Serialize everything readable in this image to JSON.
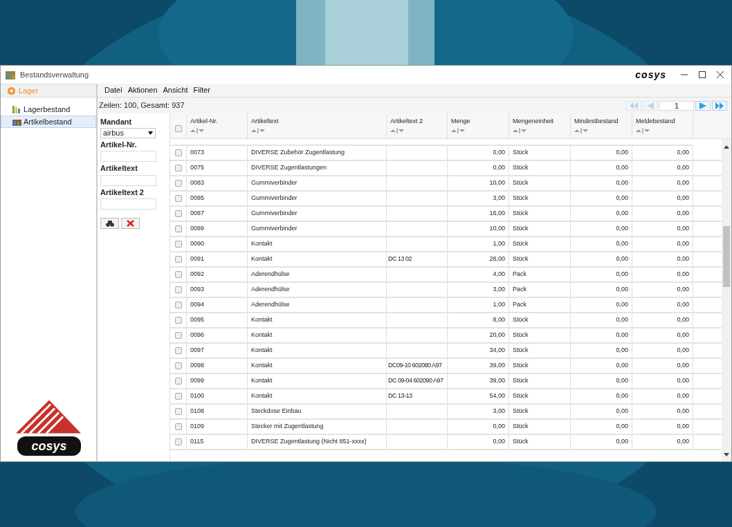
{
  "window": {
    "title": "Bestandsverwaltung",
    "logo": "cosys"
  },
  "sidebar": {
    "header": "Lager",
    "items": [
      {
        "label": "Lagerbestand",
        "selected": false
      },
      {
        "label": "Artikelbestand",
        "selected": true
      }
    ]
  },
  "menu": [
    "Datei",
    "Aktionen",
    "Ansicht",
    "Filter"
  ],
  "status": "Zeilen: 100, Gesamt: 937",
  "pager": {
    "page": "1",
    "first_disabled": true,
    "prev_disabled": true,
    "next_disabled": false,
    "last_disabled": false
  },
  "filter": {
    "mandant_label": "Mandant",
    "mandant_value": "airbus",
    "fields": [
      {
        "label": "Artikel-Nr."
      },
      {
        "label": "Artikeltext"
      },
      {
        "label": "Artikeltext 2"
      }
    ]
  },
  "sidebar_logo": "cosys",
  "table": {
    "select_all_checked": false,
    "columns": [
      "Artikel-Nr.",
      "Artikeltext",
      "Artikeltext 2",
      "Menge",
      "Mengeneinheit",
      "Mindestbestand",
      "Meldebestand"
    ],
    "rows": [
      {
        "checked": false,
        "cells": [
          "0073",
          "DIVERSE Zubehör Zugentlastung",
          "",
          "0,00",
          "Stück",
          "0,00",
          "0,00"
        ]
      },
      {
        "checked": false,
        "cells": [
          "0075",
          "DIVERSE Zugentlastungen",
          "",
          "0,00",
          "Stück",
          "0,00",
          "0,00"
        ]
      },
      {
        "checked": false,
        "cells": [
          "0083",
          "Gummiverbinder",
          "",
          "10,00",
          "Stück",
          "0,00",
          "0,00"
        ]
      },
      {
        "checked": false,
        "cells": [
          "0085",
          "Gummiverbinder",
          "",
          "3,00",
          "Stück",
          "0,00",
          "0,00"
        ]
      },
      {
        "checked": false,
        "cells": [
          "0087",
          "Gummiverbinder",
          "",
          "16,00",
          "Stück",
          "0,00",
          "0,00"
        ]
      },
      {
        "checked": false,
        "cells": [
          "0089",
          "Gummiverbinder",
          "",
          "10,00",
          "Stück",
          "0,00",
          "0,00"
        ]
      },
      {
        "checked": false,
        "cells": [
          "0090",
          "Kontakt",
          "",
          "1,00",
          "Stück",
          "0,00",
          "0,00"
        ]
      },
      {
        "checked": false,
        "cells": [
          "0091",
          "Kontakt",
          "DC 13 02",
          "28,00",
          "Stück",
          "0,00",
          "0,00"
        ]
      },
      {
        "checked": false,
        "cells": [
          "0092",
          "Aderendhülse",
          "",
          "4,00",
          "Pack",
          "0,00",
          "0,00"
        ]
      },
      {
        "checked": false,
        "cells": [
          "0093",
          "Aderendhülse",
          "",
          "3,00",
          "Pack",
          "0,00",
          "0,00"
        ]
      },
      {
        "checked": false,
        "cells": [
          "0094",
          "Aderendhülse",
          "",
          "1,00",
          "Pack",
          "0,00",
          "0,00"
        ]
      },
      {
        "checked": false,
        "cells": [
          "0095",
          "Kontakt",
          "",
          "8,00",
          "Stück",
          "0,00",
          "0,00"
        ]
      },
      {
        "checked": false,
        "cells": [
          "0096",
          "Kontakt",
          "",
          "20,00",
          "Stück",
          "0,00",
          "0,00"
        ]
      },
      {
        "checked": false,
        "cells": [
          "0097",
          "Kontakt",
          "",
          "34,00",
          "Stück",
          "0,00",
          "0,00"
        ]
      },
      {
        "checked": false,
        "cells": [
          "0098",
          "Kontakt",
          "DC09-10 602080 A97",
          "39,00",
          "Stück",
          "0,00",
          "0,00"
        ]
      },
      {
        "checked": false,
        "cells": [
          "0099",
          "Kontakt",
          "DC 09-04 602090 A97",
          "39,00",
          "Stück",
          "0,00",
          "0,00"
        ]
      },
      {
        "checked": false,
        "cells": [
          "0100",
          "Kontakt",
          "DC 13-13",
          "54,00",
          "Stück",
          "0,00",
          "0,00"
        ]
      },
      {
        "checked": false,
        "cells": [
          "0108",
          "Steckdose Einbau",
          "",
          "3,00",
          "Stück",
          "0,00",
          "0,00"
        ]
      },
      {
        "checked": false,
        "cells": [
          "0109",
          "Stecker mit Zugentlastung",
          "",
          "0,00",
          "Stück",
          "0,00",
          "0,00"
        ]
      },
      {
        "checked": false,
        "cells": [
          "0115",
          "DIVERSE Zugentlastung (Nicht 851-xxxx)",
          "",
          "0,00",
          "Stück",
          "0,00",
          "0,00"
        ]
      }
    ]
  }
}
